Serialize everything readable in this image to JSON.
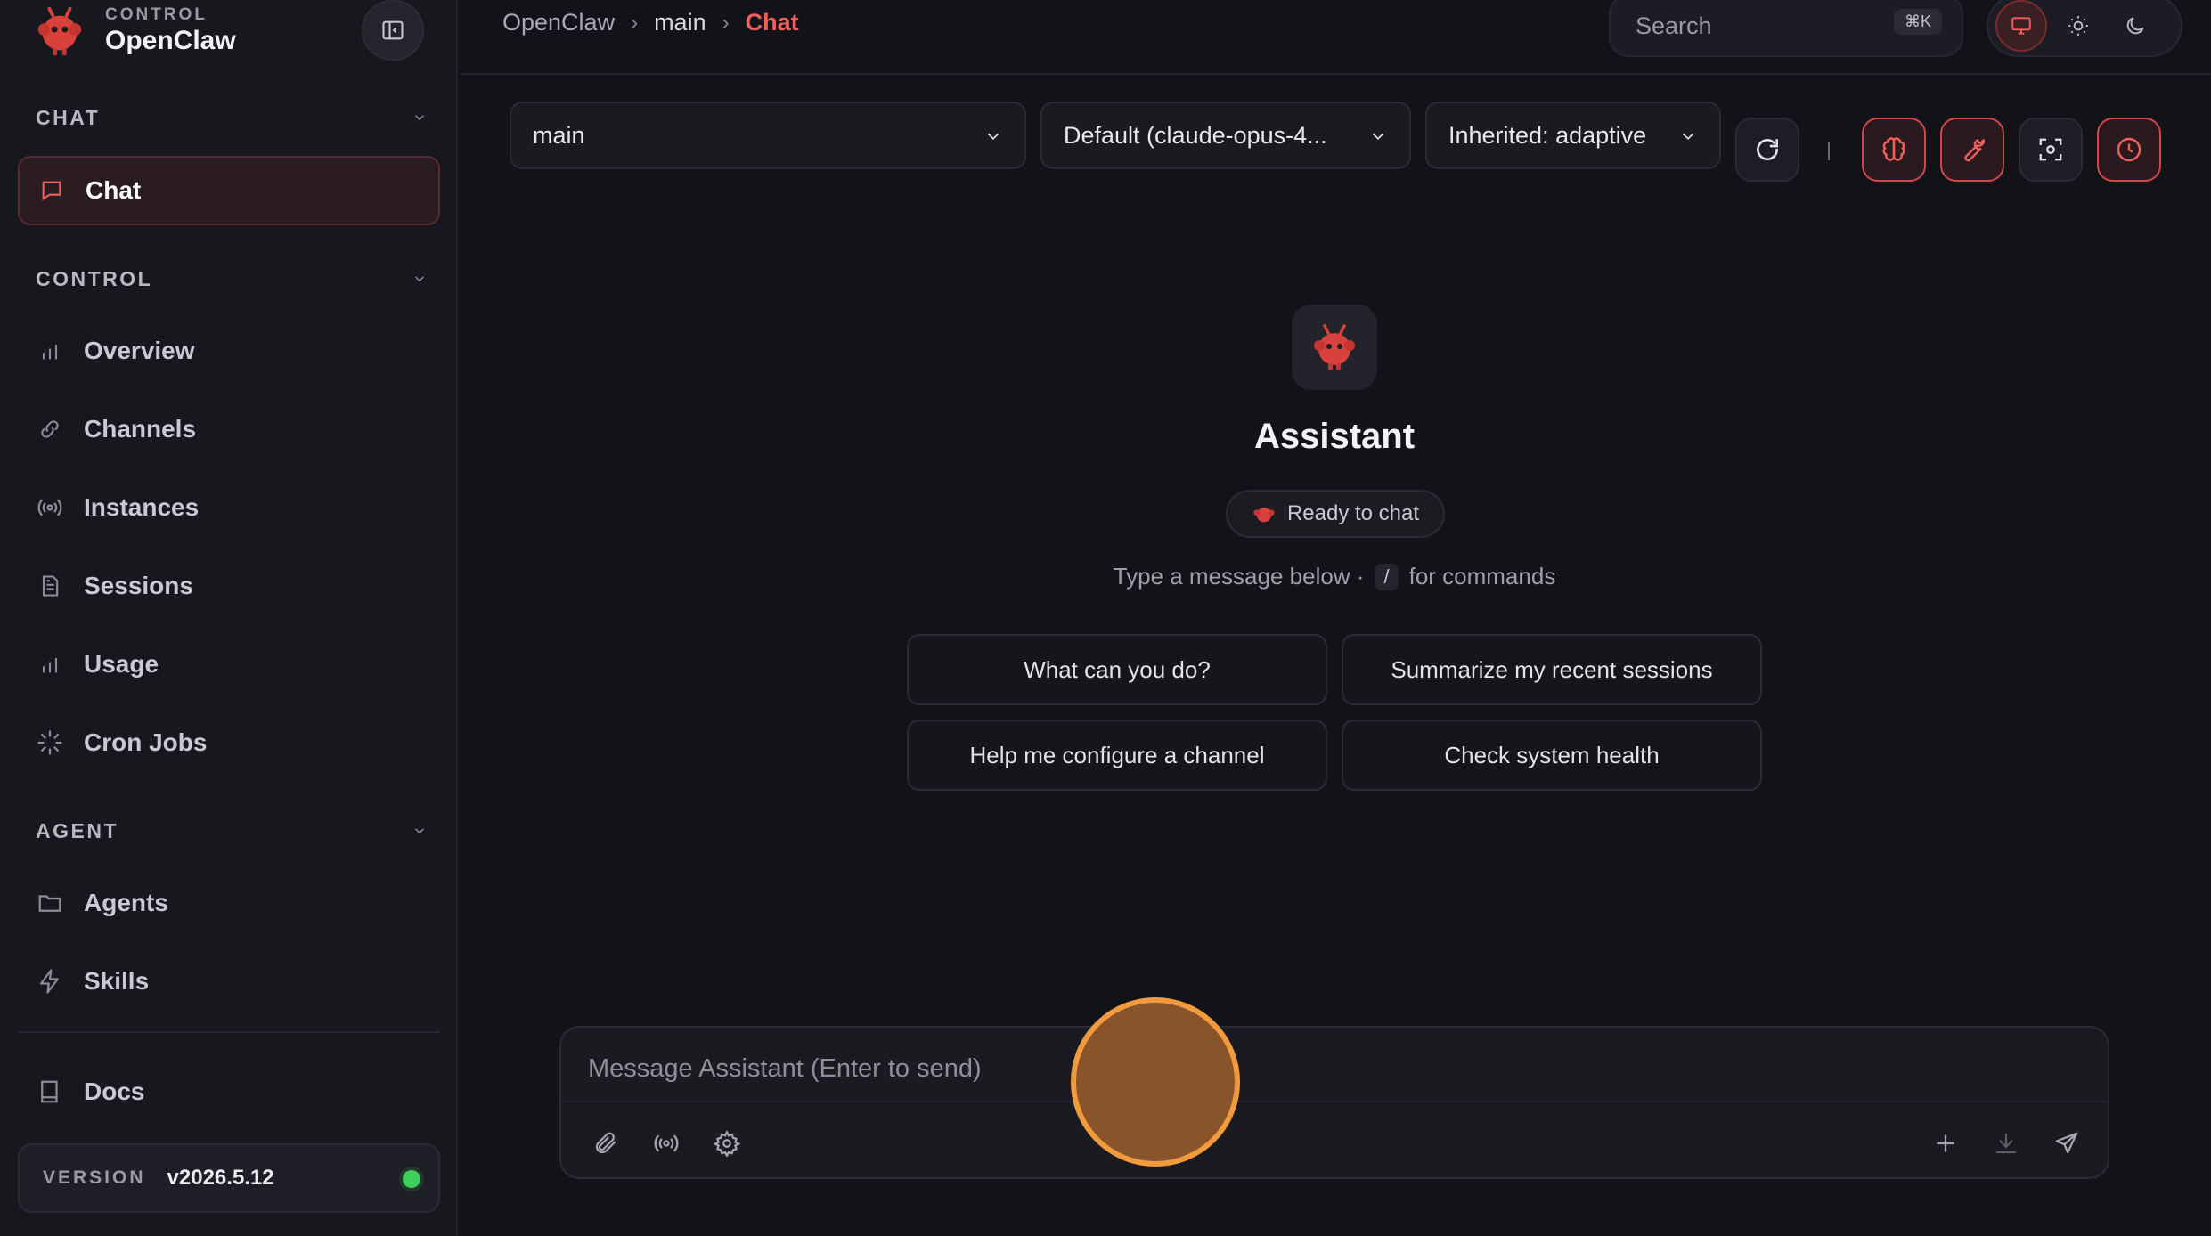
{
  "brand": {
    "eyebrow": "CONTROL",
    "name": "OpenClaw"
  },
  "sidebar": {
    "sections": [
      {
        "title": "CHAT",
        "items": [
          {
            "label": "Chat",
            "icon": "message-square-icon",
            "active": true
          }
        ]
      },
      {
        "title": "CONTROL",
        "items": [
          {
            "label": "Overview",
            "icon": "bar-chart-icon"
          },
          {
            "label": "Channels",
            "icon": "link-icon"
          },
          {
            "label": "Instances",
            "icon": "radio-icon"
          },
          {
            "label": "Sessions",
            "icon": "file-text-icon"
          },
          {
            "label": "Usage",
            "icon": "bar-chart-icon"
          },
          {
            "label": "Cron Jobs",
            "icon": "loader-icon"
          }
        ]
      },
      {
        "title": "AGENT",
        "items": [
          {
            "label": "Agents",
            "icon": "folder-icon"
          },
          {
            "label": "Skills",
            "icon": "zap-icon"
          }
        ]
      }
    ],
    "docs": {
      "label": "Docs",
      "icon": "book-icon"
    },
    "version": {
      "label": "VERSION",
      "value": "v2026.5.12",
      "status_color": "#3ecf5c"
    }
  },
  "breadcrumb": {
    "root": "OpenClaw",
    "middle": "main",
    "current": "Chat",
    "separator": "›"
  },
  "search": {
    "placeholder": "Search",
    "shortcut": "⌘K"
  },
  "toolbar": {
    "session_select": "main",
    "model_select": "Default (claude-opus-4...",
    "thinking_select": "Inherited: adaptive",
    "separator": "|"
  },
  "assistant": {
    "title": "Assistant",
    "status": "Ready to chat",
    "hint_before": "Type a message below ·",
    "hint_key": "/",
    "hint_after": "for commands"
  },
  "suggestions": [
    "What can you do?",
    "Summarize my recent sessions",
    "Help me configure a channel",
    "Check system health"
  ],
  "composer": {
    "placeholder": "Message Assistant (Enter to send)"
  },
  "colors": {
    "accent": "#f0605a",
    "accent_border": "#d0474a",
    "background": "#121318",
    "sidebar": "#17181e"
  }
}
